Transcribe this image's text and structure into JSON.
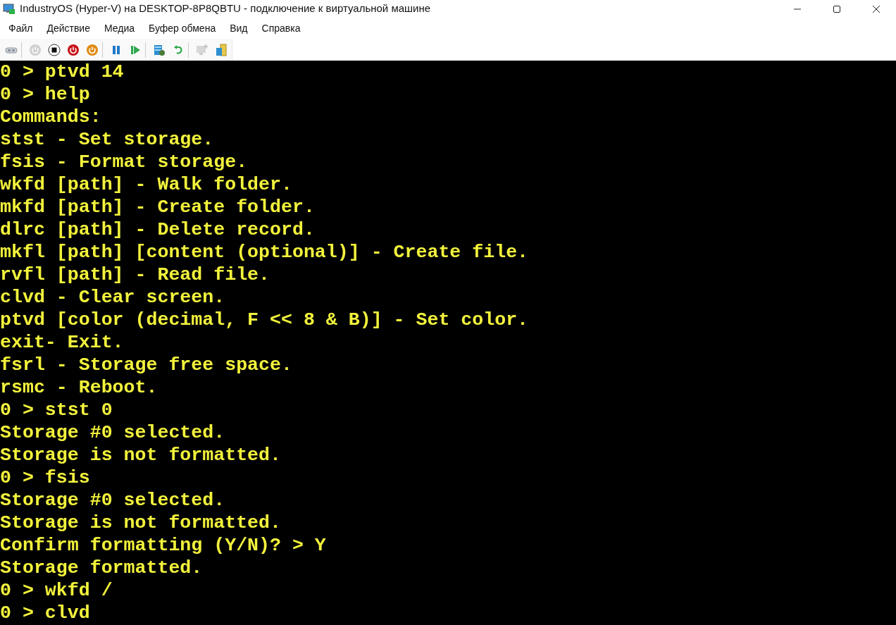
{
  "window": {
    "title": "IndustryOS (Hyper-V) на DESKTOP-8P8QBTU - подключение к виртуальной машине"
  },
  "menu": [
    "Файл",
    "Действие",
    "Медиа",
    "Буфер обмена",
    "Вид",
    "Справка"
  ],
  "toolbar": [
    {
      "kind": "ctrl-alt-del",
      "disabled": false
    },
    {
      "kind": "start",
      "disabled": true
    },
    {
      "kind": "turn-off",
      "disabled": false
    },
    {
      "kind": "shut-down",
      "disabled": false
    },
    {
      "kind": "save",
      "disabled": false
    },
    {
      "kind": "pause",
      "disabled": false
    },
    {
      "kind": "reset",
      "disabled": false
    },
    {
      "kind": "checkpoint",
      "disabled": false
    },
    {
      "kind": "revert",
      "disabled": false
    },
    {
      "kind": "enhanced-session",
      "disabled": true
    },
    {
      "kind": "share",
      "disabled": false
    }
  ],
  "console": {
    "lines": [
      "0 > ptvd 14",
      "0 > help",
      "Commands:",
      "stst - Set storage.",
      "fsis - Format storage.",
      "wkfd [path] - Walk folder.",
      "mkfd [path] - Create folder.",
      "dlrc [path] - Delete record.",
      "mkfl [path] [content (optional)] - Create file.",
      "rvfl [path] - Read file.",
      "clvd - Clear screen.",
      "ptvd [color (decimal, F << 8 & B)] - Set color.",
      "exit- Exit.",
      "fsrl - Storage free space.",
      "rsmc - Reboot.",
      "0 > stst 0",
      "Storage #0 selected.",
      "Storage is not formatted.",
      "0 > fsis",
      "Storage #0 selected.",
      "Storage is not formatted.",
      "Confirm formatting (Y/N)? > Y",
      "Storage formatted.",
      "0 > wkfd /",
      "0 > clvd"
    ]
  }
}
